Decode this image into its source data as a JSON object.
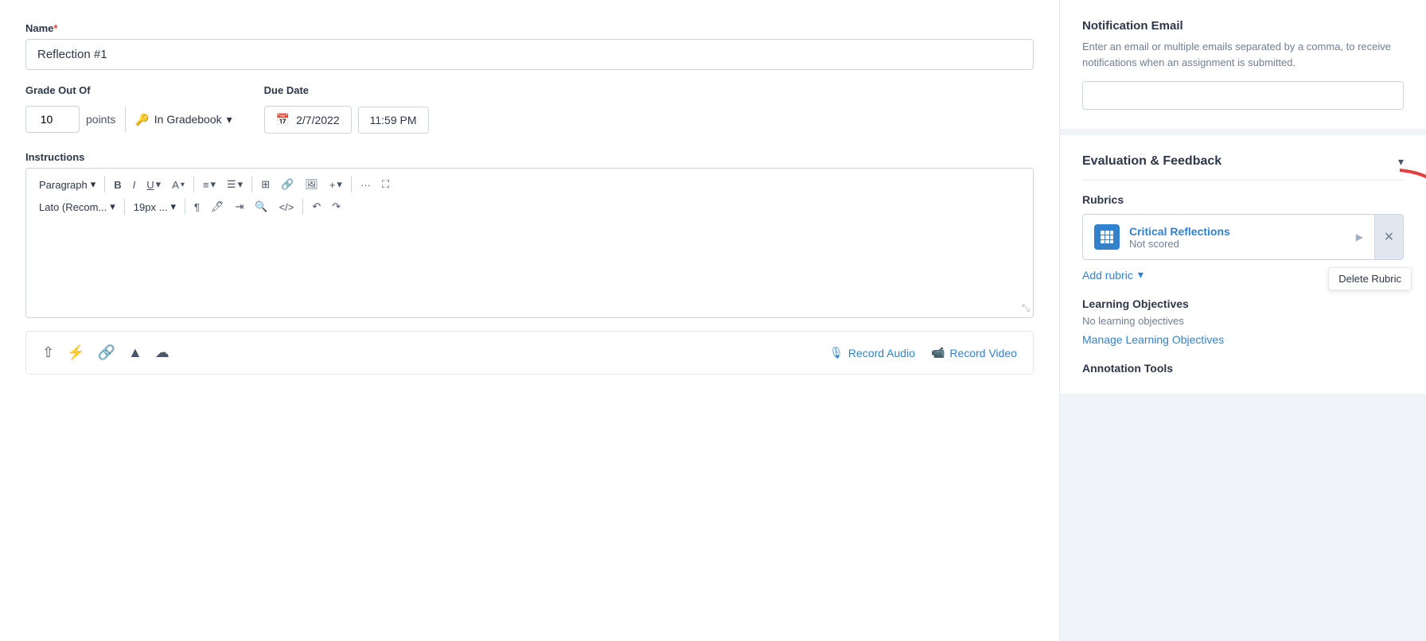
{
  "left": {
    "name_label": "Name",
    "required_marker": "*",
    "name_value": "Reflection #1",
    "grade_label": "Grade Out Of",
    "grade_value": "10",
    "points_label": "points",
    "gradebook_label": "In Gradebook",
    "due_date_label": "Due Date",
    "due_date_value": "2/7/2022",
    "due_time_value": "11:59 PM",
    "instructions_label": "Instructions",
    "toolbar": {
      "paragraph": "Paragraph",
      "font": "Lato (Recom...",
      "size": "19px ...",
      "bold": "B",
      "italic": "I",
      "more": "···",
      "fullscreen": "⛶"
    },
    "media": {
      "record_audio_label": "Record Audio",
      "record_video_label": "Record Video"
    }
  },
  "right": {
    "notification": {
      "title": "Notification Email",
      "description": "Enter an email or multiple emails separated by a comma, to receive notifications when an assignment is submitted.",
      "placeholder": ""
    },
    "evaluation": {
      "title": "Evaluation & Feedback",
      "rubrics_label": "Rubrics",
      "rubric": {
        "name": "Critical Reflections",
        "score": "Not scored",
        "delete_tooltip": "Delete Rubric"
      },
      "add_rubric_label": "Add rubric",
      "learning": {
        "title": "Learning Objectives",
        "no_objectives": "No learning objectives",
        "manage_label": "Manage Learning Objectives"
      },
      "annotation": {
        "title": "Annotation Tools"
      }
    }
  }
}
